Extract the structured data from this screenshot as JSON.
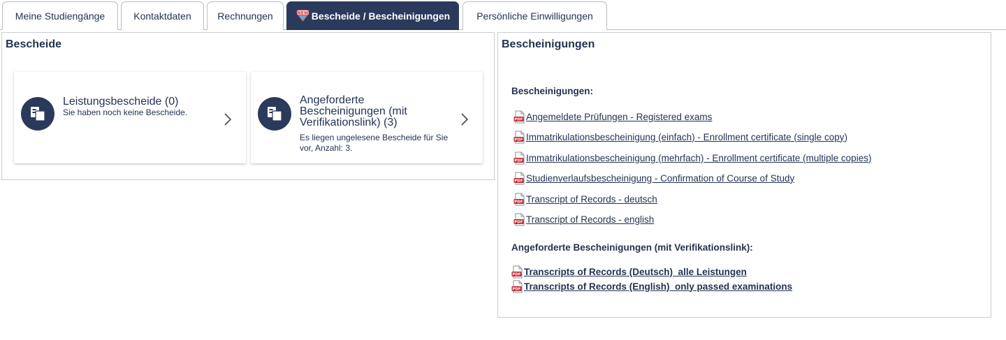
{
  "tabs": [
    {
      "label": "Meine Studiengänge",
      "active": false
    },
    {
      "label": "Kontaktdaten",
      "active": false
    },
    {
      "label": "Rechnungen",
      "active": false
    },
    {
      "label": "Bescheide / Bescheinigungen",
      "active": true,
      "badge": "NEW"
    },
    {
      "label": "Persönliche Einwilligungen",
      "active": false
    }
  ],
  "bescheide": {
    "title": "Bescheide",
    "cards": [
      {
        "title": "Leistungsbescheide (0)",
        "subtitle": "Sie haben noch keine Bescheide."
      },
      {
        "title": "Angeforderte Bescheinigungen (mit Verifikationslink) (3)",
        "subtitle": "Es liegen ungelesene Bescheide für Sie vor, Anzahl: 3."
      }
    ]
  },
  "bescheinigungen": {
    "title": "Bescheinigungen",
    "section1_heading": "Bescheinigungen:",
    "links": [
      "Angemeldete Prüfungen - Registered exams",
      "Immatrikulationsbescheinigung (einfach) - Enrollment certificate (single copy)",
      "Immatrikulationsbescheinigung (mehrfach) - Enrollment certificate (multiple copies)",
      "Studienverlaufsbescheinigung - Confirmation of Course of Study",
      "Transcript of Records - deutsch",
      "Transcript of Records - english"
    ],
    "section2_heading": "Angeforderte Bescheinigungen (mit Verifikationslink):",
    "requested_links": [
      "Transcripts of Records (Deutsch)_alle Leistungen",
      "Transcripts of Records (English)_only passed examinations"
    ]
  },
  "colors": {
    "accent": "#2b3a5c",
    "text": "#243352",
    "pdf_red": "#c0272d"
  },
  "icons": {
    "tab_badge": "new-badge-icon",
    "card_icon": "documents-icon",
    "chevron": "chevron-right-icon",
    "link_icon": "pdf-icon"
  }
}
